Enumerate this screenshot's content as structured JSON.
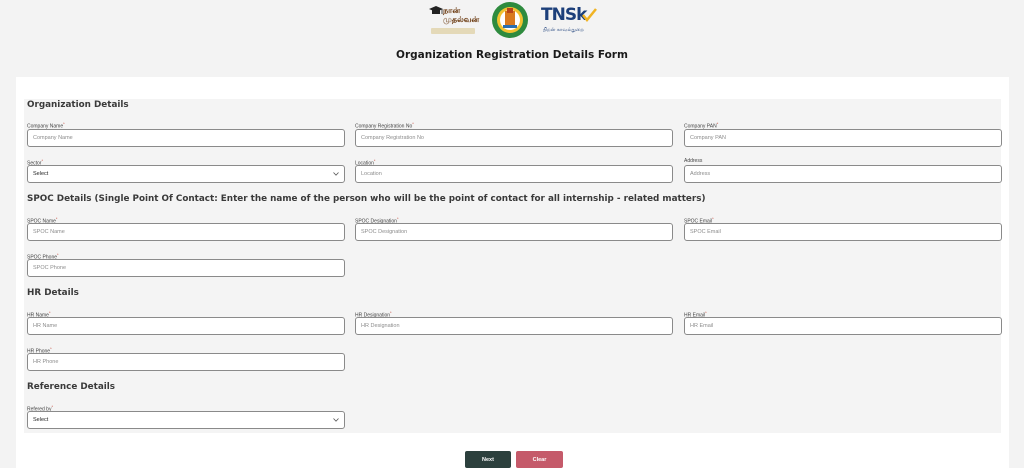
{
  "logos": {
    "naan_text": "நான் முதல்வன்",
    "tnsk_text": "TNSk",
    "tnsk_sub": "திறன் காவல்துறை"
  },
  "page_title": "Organization Registration Details Form",
  "sections": {
    "organization": "Organization Details",
    "spoc": "SPOC Details (Single Point Of Contact: Enter the name of the person who will be the point of contact for all internship - related matters)",
    "hr": "HR Details",
    "reference": "Reference Details"
  },
  "fields": {
    "company_name": {
      "label": "Company Name",
      "placeholder": "Company Name"
    },
    "company_reg": {
      "label": "Company Registration No",
      "placeholder": "Company Registration No"
    },
    "company_pan": {
      "label": "Company PAN",
      "placeholder": "Company PAN"
    },
    "sector": {
      "label": "Sector",
      "value": "Select"
    },
    "location": {
      "label": "Location",
      "placeholder": "Location"
    },
    "address": {
      "label": "Address",
      "placeholder": "Address"
    },
    "spoc_name": {
      "label": "SPOC Name",
      "placeholder": "SPOC Name"
    },
    "spoc_designation": {
      "label": "SPOC Designation",
      "placeholder": "SPOC Designation"
    },
    "spoc_email": {
      "label": "SPOC Email",
      "placeholder": "SPOC Email"
    },
    "spoc_phone": {
      "label": "SPOC Phone",
      "placeholder": "SPOC Phone"
    },
    "hr_name": {
      "label": "HR Name",
      "placeholder": "HR Name"
    },
    "hr_designation": {
      "label": "HR Designation",
      "placeholder": "HR Designation"
    },
    "hr_email": {
      "label": "HR Email",
      "placeholder": "HR Email"
    },
    "hr_phone": {
      "label": "HR Phone",
      "placeholder": "HR Phone"
    },
    "referred_by": {
      "label": "Refered by",
      "value": "Select"
    }
  },
  "required_mark": "*",
  "buttons": {
    "next": "Next",
    "clear": "Clear"
  },
  "colors": {
    "next_button": "#2c403d",
    "clear_button": "#c55a6a",
    "required_mark": "#c0392b",
    "logo_blue": "#1c3f7a"
  },
  "icons": {
    "select_chevron": "chevron-down-icon",
    "naan_logo": "graduation-cap-icon",
    "tn_emblem": "tamil-nadu-emblem-icon",
    "tnsk_tick": "checkmark-icon"
  }
}
